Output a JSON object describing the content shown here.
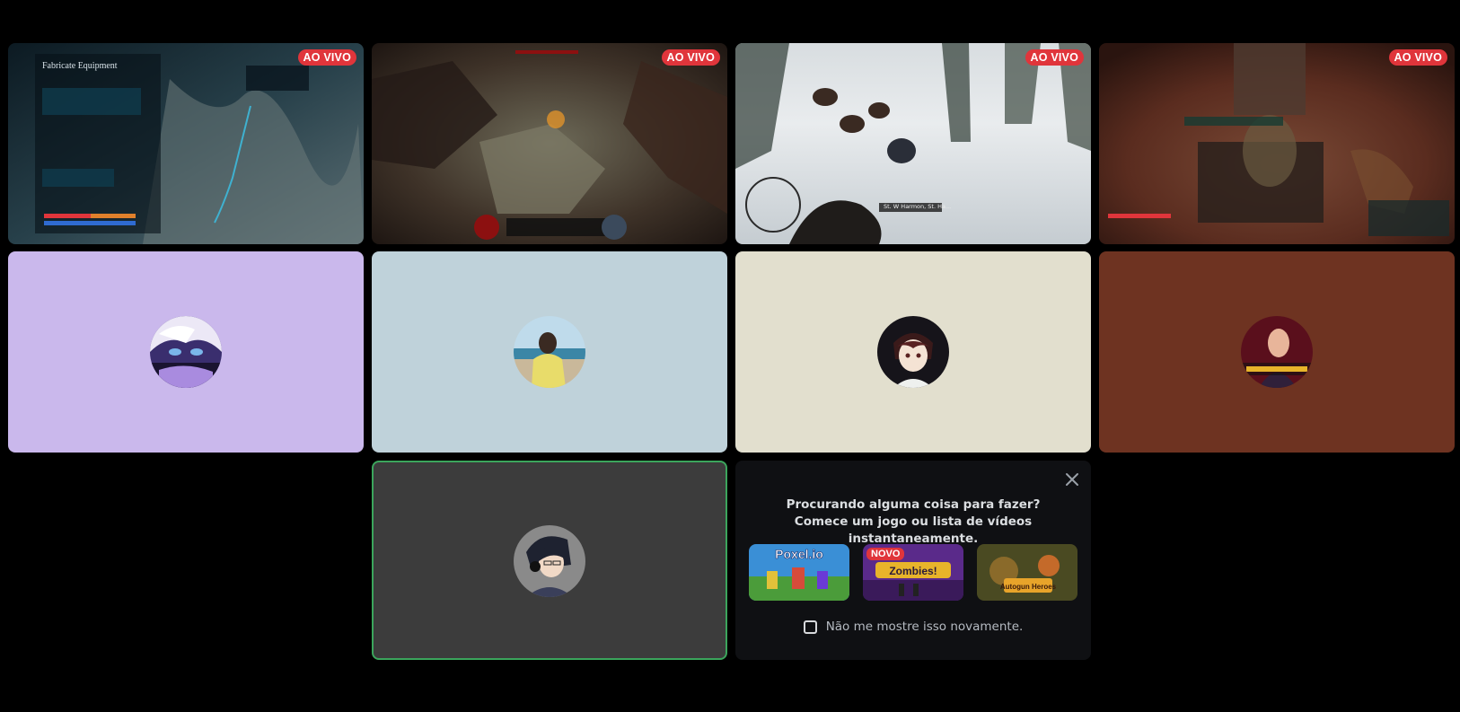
{
  "live_badge": "AO VIVO",
  "streams": [
    {
      "id": "stream-1",
      "game_texts": [
        "Fabricate Equipment"
      ]
    },
    {
      "id": "stream-2"
    },
    {
      "id": "stream-3",
      "subtitle": "St. W Harmon, St. Ha..."
    },
    {
      "id": "stream-4"
    }
  ],
  "participants": [
    {
      "bg": "#cab8ec"
    },
    {
      "bg": "#bfd2da"
    },
    {
      "bg": "#e2dfce"
    },
    {
      "bg": "#6e3321"
    }
  ],
  "self_tile": {
    "bg": "#3c3c3c",
    "speaking_border": "#3ba55c"
  },
  "activity_prompt": {
    "line1": "Procurando alguma coisa para fazer?",
    "line2": "Comece um jogo ou lista de vídeos instantaneamente.",
    "games": [
      {
        "name": "Poxel.io",
        "badge": ""
      },
      {
        "name": "Zombies!",
        "badge": "NOVO"
      },
      {
        "name": "Autogun Heroes",
        "badge": ""
      }
    ],
    "checkbox_label": "Não me mostre isso novamente.",
    "checkbox_checked": false
  },
  "icons": {
    "close": "close-icon",
    "checkbox": "checkbox-icon"
  }
}
